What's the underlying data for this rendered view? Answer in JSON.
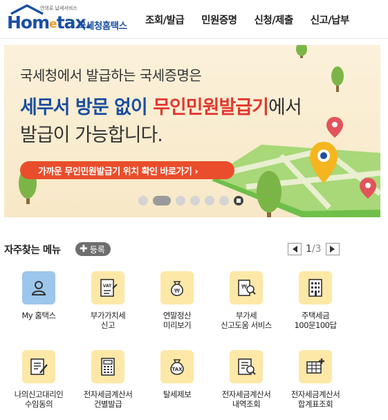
{
  "header": {
    "tagline": "안의로 납세서비스",
    "brand_main": "Hom",
    "brand_e": "e",
    "brand_tail": "tax.",
    "site_name": "국세청홈택스",
    "nav": [
      "조회/발급",
      "민원증명",
      "신청/제출",
      "신고/납부"
    ]
  },
  "banner": {
    "line1": "국세청에서 발급하는 국세증명은",
    "line2_blue": "세무서 방문 없이 ",
    "line2_red": "무인민원발급기",
    "line2_tail": "에서",
    "line3": "발급이 가능합니다.",
    "cta_label": "가까운 무인민원발급기 위치 확인 바로가기 ›",
    "slides_total": 6,
    "active_slide": 2
  },
  "quick_menu": {
    "title": "자주찾는 메뉴",
    "add_label": "등록",
    "page_current": "1",
    "page_sep": "/",
    "page_total": "3",
    "items": [
      {
        "label": "My 홈택스",
        "icon": "person-icon"
      },
      {
        "label": "부가가치세\n신고",
        "icon": "vat-document-icon"
      },
      {
        "label": "연말정산\n미리보기",
        "icon": "money-bag-icon"
      },
      {
        "label": "부가세\n신고도움 서비스",
        "icon": "document-search-icon"
      },
      {
        "label": "주택세금\n100문100답",
        "icon": "building-icon"
      },
      {
        "label": "나의신고대리인\n수임동의",
        "icon": "document-pen-icon"
      },
      {
        "label": "전자세금계산서\n건별발급",
        "icon": "calculator-icon"
      },
      {
        "label": "탈세제보",
        "icon": "tax-bag-icon"
      },
      {
        "label": "전자세금계산서\n내역조회",
        "icon": "list-search-icon"
      },
      {
        "label": "전자세금계산서\n합계표조회",
        "icon": "table-plus-icon"
      }
    ]
  },
  "colors": {
    "brand_blue": "#1c4fa3",
    "brand_orange": "#f39a1e",
    "cta_red": "#ea4d2b",
    "highlight_red": "#e2382f",
    "icon_yellow": "#fde8a7",
    "icon_blue": "#9cc6ec"
  }
}
